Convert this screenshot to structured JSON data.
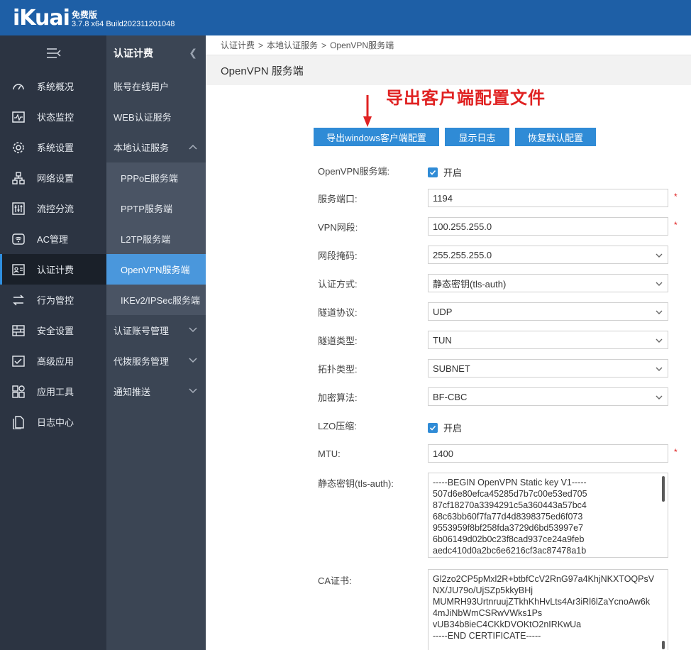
{
  "header": {
    "logo": "iKuai",
    "edition": "免费版",
    "version": "3.7.8 x64 Build202311201048"
  },
  "nav": {
    "toggle_icon": "menu-collapse-icon",
    "items": [
      {
        "label": "系统概况",
        "icon": "dashboard-icon"
      },
      {
        "label": "状态监控",
        "icon": "pulse-icon"
      },
      {
        "label": "系统设置",
        "icon": "gear-icon"
      },
      {
        "label": "网络设置",
        "icon": "network-icon"
      },
      {
        "label": "流控分流",
        "icon": "sliders-icon"
      },
      {
        "label": "AC管理",
        "icon": "wifi-icon"
      },
      {
        "label": "认证计费",
        "icon": "id-card-icon"
      },
      {
        "label": "行为管控",
        "icon": "swap-icon"
      },
      {
        "label": "安全设置",
        "icon": "firewall-icon"
      },
      {
        "label": "高级应用",
        "icon": "checklist-icon"
      },
      {
        "label": "应用工具",
        "icon": "apps-icon"
      },
      {
        "label": "日志中心",
        "icon": "document-icon"
      }
    ],
    "active_index": 6
  },
  "subnav": {
    "title": "认证计费",
    "items": [
      {
        "label": "账号在线用户"
      },
      {
        "label": "WEB认证服务"
      },
      {
        "label": "本地认证服务",
        "expanded": true
      }
    ],
    "children": [
      "PPPoE服务端",
      "PPTP服务端",
      "L2TP服务端",
      "OpenVPN服务端",
      "IKEv2/IPSec服务端"
    ],
    "active_child": 3,
    "more": [
      "认证账号管理",
      "代拨服务管理",
      "通知推送"
    ]
  },
  "breadcrumb": [
    "认证计费",
    "本地认证服务",
    "OpenVPN服务端"
  ],
  "page_title": "OpenVPN 服务端",
  "annotation": "导出客户端配置文件",
  "buttons": {
    "export": "导出windows客户端配置",
    "log": "显示日志",
    "reset": "恢复默认配置"
  },
  "form": {
    "enable_label": "OpenVPN服务端:",
    "enable_text": "开启",
    "port_label": "服务端口:",
    "port_value": "1194",
    "vpn_net_label": "VPN网段:",
    "vpn_net_value": "100.255.255.0",
    "mask_label": "网段掩码:",
    "mask_value": "255.255.255.0",
    "auth_label": "认证方式:",
    "auth_value": "静态密钥(tls-auth)",
    "proto_label": "隧道协议:",
    "proto_value": "UDP",
    "tun_label": "隧道类型:",
    "tun_value": "TUN",
    "topo_label": "拓扑类型:",
    "topo_value": "SUBNET",
    "cipher_label": "加密算法:",
    "cipher_value": "BF-CBC",
    "lzo_label": "LZO压缩:",
    "lzo_text": "开启",
    "mtu_label": "MTU:",
    "mtu_value": "1400",
    "required_mark": "*",
    "static_key_label": "静态密钥(tls-auth):",
    "static_key_lines": [
      "-----BEGIN OpenVPN Static key V1-----",
      "507d6e80efca45285d7b7c00e53ed705",
      "87cf18270a3394291c5a360443a57bc4",
      "68c63bb60f7fa77d4d8398375ed6f073",
      "9553959f8bf258fda3729d6bd53997e7",
      "6b06149d02b0c23f8cad937ce24a9feb",
      "aedc410d0a2bc6e6216cf3ac87478a1b"
    ],
    "ca_label": "CA证书:",
    "ca_lines": [
      "Gl2zo2CP5pMxl2R+btbfCcV2RnG97a4KhjNKXTOQPsV",
      "NX/JU79o/UjSZp5kkyBHj",
      "MUMRH93UrtnruujZTkhKhHvLts4Ar3iRl6lZaYcnoAw6k",
      "4mJiNbWmCSRwVWks1Ps",
      "vUB34b8ieC4CKkDVOKtO2nIRKwUa",
      "-----END CERTIFICATE-----"
    ]
  }
}
